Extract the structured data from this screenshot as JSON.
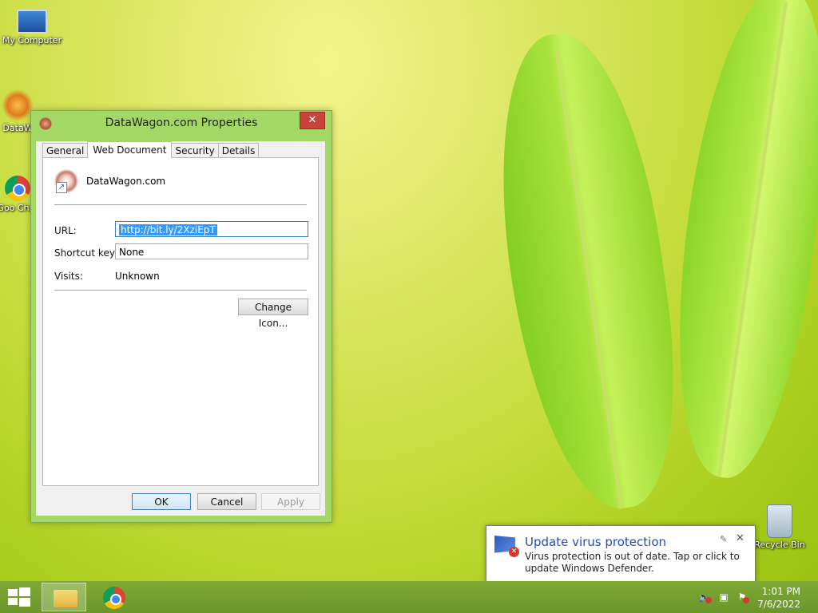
{
  "desktop": {
    "icons": [
      {
        "label": "My Computer"
      },
      {
        "label": "DataW"
      },
      {
        "label": "Goo Chro"
      },
      {
        "label": "Recycle Bin"
      }
    ]
  },
  "dialog": {
    "title": "DataWagon.com Properties",
    "close_label": "✕",
    "tabs": [
      {
        "label": "General"
      },
      {
        "label": "Web Document"
      },
      {
        "label": "Security"
      },
      {
        "label": "Details"
      }
    ],
    "active_tab": "Web Document",
    "site_name": "DataWagon.com",
    "url_label": "URL:",
    "url_value": "http://bit.ly/2XziEpT",
    "shortcut_label": "Shortcut key:",
    "shortcut_value": "None",
    "visits_label": "Visits:",
    "visits_value": "Unknown",
    "change_icon_label": "Change Icon...",
    "ok_label": "OK",
    "cancel_label": "Cancel",
    "apply_label": "Apply"
  },
  "notification": {
    "title": "Update virus protection",
    "message": "Virus protection is out of date. Tap or click to update Windows Defender.",
    "pin_icon": "pin-icon",
    "close_label": "✕"
  },
  "taskbar": {
    "time": "1:01 PM",
    "date": "7/6/2022",
    "colors": {
      "taskbar": "#7ea934",
      "accent": "#3c7fb1",
      "error": "#d23a30"
    }
  }
}
